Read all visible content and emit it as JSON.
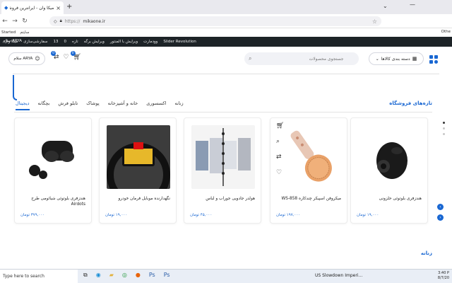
{
  "browser": {
    "tab_title": "میکا وان - ایرانترین فروشگاه در",
    "tab_close": "×",
    "new_tab": "+",
    "url": "mikaone.ir",
    "bookmarks": [
      "Started",
      "سایتم"
    ],
    "bookmarks_other": "Othe"
  },
  "wp_admin": {
    "items": [
      "میکا وان",
      "سفارشی‌سازی",
      "13",
      "0",
      "تازه",
      "ویرایش برگه",
      "ویرایش با المنتور",
      "وودمارت",
      "Slider Revolution"
    ],
    "greeting": "سلام ARYA"
  },
  "header": {
    "category_button": "دسته بندی کالاها",
    "search_placeholder": "جستجوی محصولات",
    "account_label": "سلام ARYA",
    "compare_badge": "0",
    "cart_badge": "0"
  },
  "section": {
    "title": "تازه‌های فروشگاه",
    "tabs": [
      "دیجیتال",
      "بچگانه",
      "تابلو فرش",
      "پوشاک",
      "خانه و آشپزخانه",
      "اکسسوری",
      "زنانه"
    ],
    "active_tab": "دیجیتال"
  },
  "products": [
    {
      "name": "هندزفری بلوتوثی حلزونی",
      "price": "۱۹,۰۰۰ تومان"
    },
    {
      "name": "میکروفن اسپیکر چندکاره WS-858",
      "price": "۱۹۷,۰۰۰ تومان"
    },
    {
      "name": "هولدر جادویی جوراب و لباس",
      "price": "۴۵,۰۰۰ تومان"
    },
    {
      "name": "نگهدارنده موبایل فرمان خودرو",
      "price": "۱۹,۰۰۰ تومان"
    },
    {
      "name": "هندزفری بلوتوثی شیائومی طرح Airdots",
      "price": "۳۷۹,۰۰۰ تومان"
    }
  ],
  "section2": {
    "title": "زنانه"
  },
  "taskbar": {
    "search_placeholder": "Type here to search",
    "news": "US Slowdown Imperi...",
    "time": "3:40 P",
    "date": "8/7/20"
  },
  "colors": {
    "accent": "#1967d2",
    "wp_bar": "#1d2327"
  }
}
